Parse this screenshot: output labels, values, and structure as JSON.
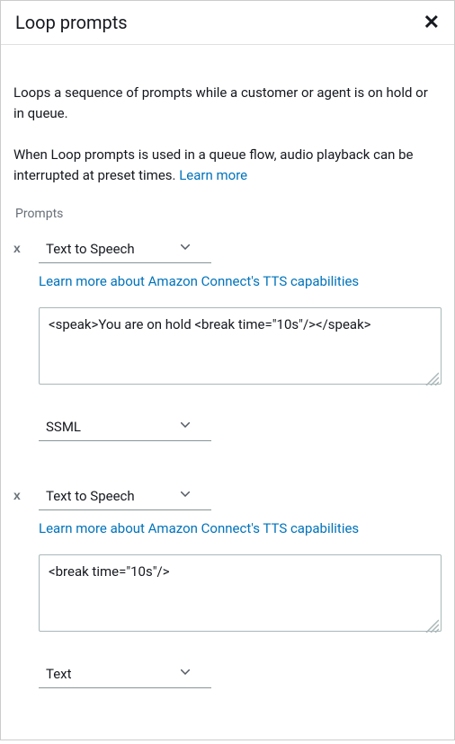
{
  "header": {
    "title": "Loop prompts"
  },
  "description": {
    "para1": "Loops a sequence of prompts while a customer or agent is on hold or in queue.",
    "para2_prefix": "When Loop prompts is used in a queue flow, audio playback can be interrupted at preset times. ",
    "learn_more": "Learn more"
  },
  "section_label": "Prompts",
  "prompts": [
    {
      "type": "Text to Speech",
      "tts_link": "Learn more about Amazon Connect's TTS capabilities",
      "value": "<speak>You are on hold <break time=\"10s\"/></speak>",
      "format": "SSML"
    },
    {
      "type": "Text to Speech",
      "tts_link": "Learn more about Amazon Connect's TTS capabilities",
      "value": "<break time=\"10s\"/>",
      "format": "Text"
    }
  ],
  "remove_label": "x"
}
